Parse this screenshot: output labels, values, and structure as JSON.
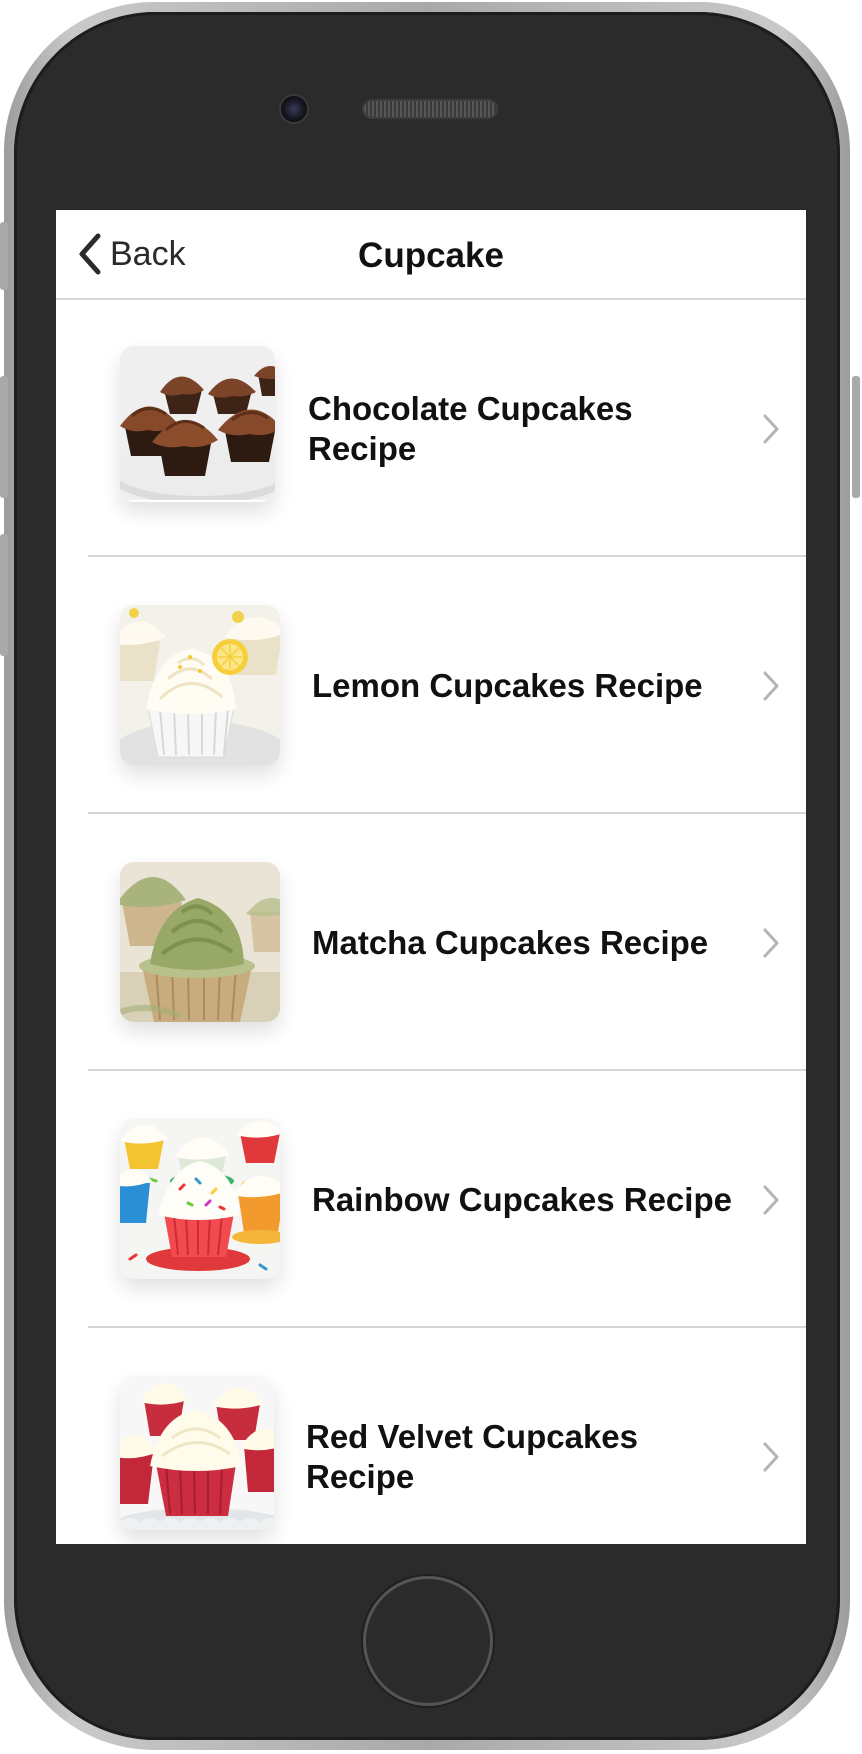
{
  "nav": {
    "back_label": "Back",
    "title": "Cupcake"
  },
  "recipes": [
    {
      "name": "Chocolate Cupcakes Recipe",
      "icon": "chocolate-cupcake-photo"
    },
    {
      "name": "Lemon Cupcakes Recipe",
      "icon": "lemon-cupcake-photo"
    },
    {
      "name": "Matcha Cupcakes Recipe",
      "icon": "matcha-cupcake-photo"
    },
    {
      "name": "Rainbow Cupcakes Recipe",
      "icon": "rainbow-cupcake-photo"
    },
    {
      "name": "Red Velvet Cupcakes Recipe",
      "icon": "red-velvet-cupcake-photo"
    }
  ],
  "colors": {
    "frame": "#2b2b2b",
    "screen_bg": "#ffffff",
    "divider": "#d6d6d6",
    "chevron": "#b4b4b4"
  }
}
